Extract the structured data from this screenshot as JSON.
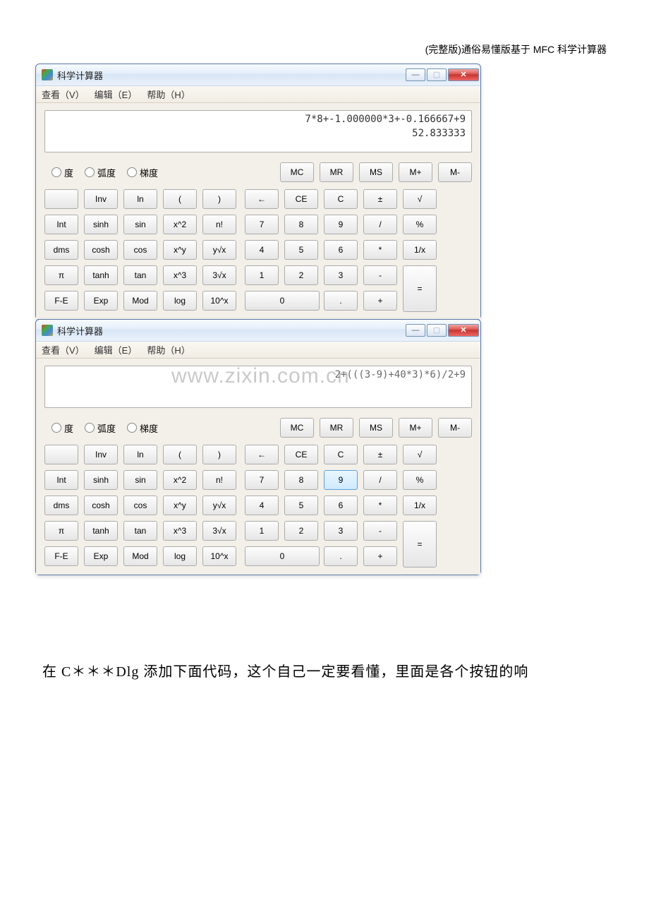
{
  "header": "(完整版)通俗易懂版基于 MFC 科学计算器",
  "watermark": "www.zixin.com.cn",
  "window": {
    "title": "科学计算器",
    "menu": {
      "view": "查看（V）",
      "edit": "编辑（E）",
      "help": "帮助（H）"
    },
    "controls": {
      "min": "—",
      "max": "▢",
      "close": "✕"
    }
  },
  "calc1": {
    "line1": "7*8+-1.000000*3+-0.166667+9",
    "line2": "52.833333"
  },
  "calc2": {
    "line1": "2+(((3-9)+40*3)*6)/2+9",
    "line2": ""
  },
  "radios": {
    "deg": "度",
    "rad": "弧度",
    "grad": "梯度"
  },
  "mem": {
    "mc": "MC",
    "mr": "MR",
    "ms": "MS",
    "mplus": "M+",
    "mminus": "M-"
  },
  "funcRow1": {
    "blank": "",
    "inv": "Inv",
    "ln": "ln",
    "lparen": "(",
    "rparen": ")"
  },
  "opRow1": {
    "back": "←",
    "ce": "CE",
    "c": "C",
    "pm": "±",
    "sqrt": "√"
  },
  "funcRow2": {
    "int": "Int",
    "sinh": "sinh",
    "sin": "sin",
    "x2": "x^2",
    "fact": "n!"
  },
  "numRow1": {
    "n7": "7",
    "n8": "8",
    "n9": "9",
    "div": "/",
    "pct": "%"
  },
  "funcRow3": {
    "dms": "dms",
    "cosh": "cosh",
    "cos": "cos",
    "xy": "x^y",
    "yrtx": "y√x"
  },
  "numRow2": {
    "n4": "4",
    "n5": "5",
    "n6": "6",
    "mul": "*",
    "recip": "1/x"
  },
  "funcRow4": {
    "pi": "π",
    "tanh": "tanh",
    "tan": "tan",
    "x3": "x^3",
    "crt": "3√x"
  },
  "numRow3": {
    "n1": "1",
    "n2": "2",
    "n3": "3",
    "sub": "-",
    "eq": "="
  },
  "funcRow5": {
    "fe": "F-E",
    "exp": "Exp",
    "mod": "Mod",
    "log": "log",
    "tenx": "10^x"
  },
  "numRow4": {
    "n0": "0",
    "dot": ".",
    "add": "+"
  },
  "bodyText": "在 C＊＊＊Dlg 添加下面代码，这个自己一定要看懂，里面是各个按钮的响"
}
